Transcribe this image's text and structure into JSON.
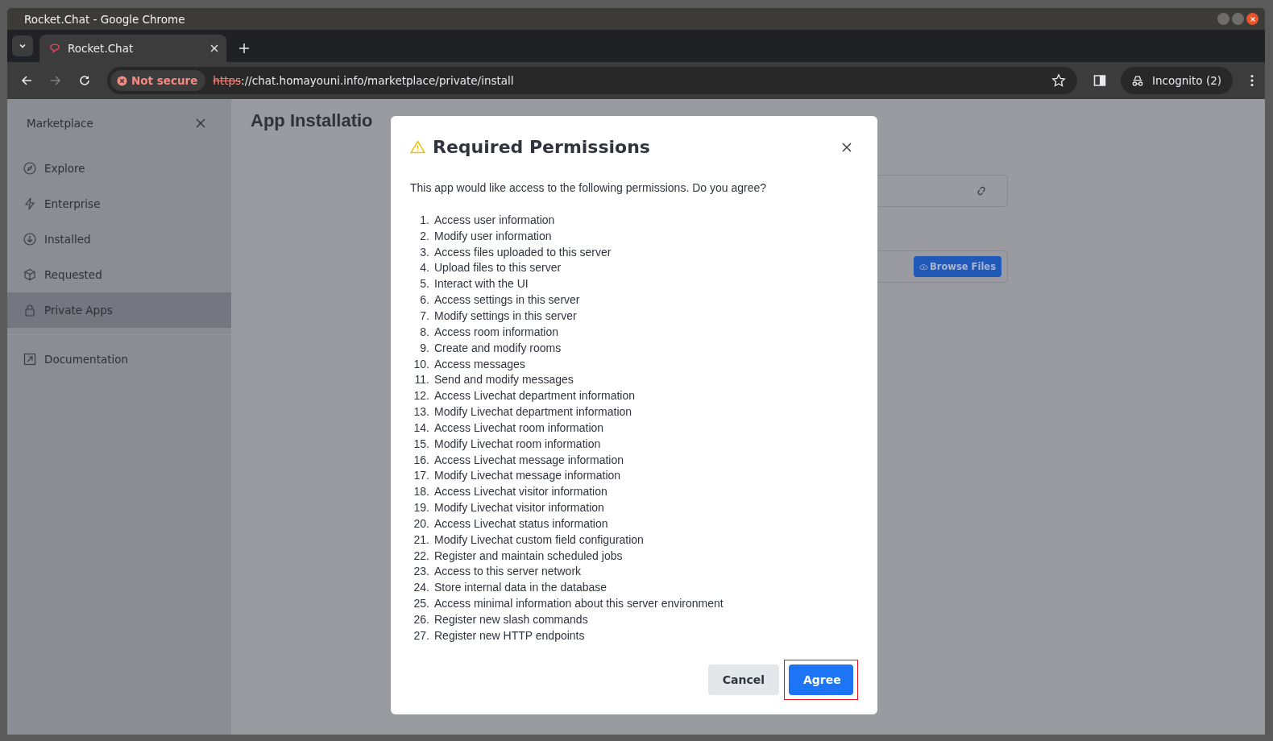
{
  "window": {
    "title": "Rocket.Chat - Google Chrome"
  },
  "tabs": [
    {
      "label": "Rocket.Chat",
      "selected": true
    }
  ],
  "toolbar": {
    "forward_disabled": true,
    "security_label": "Not secure",
    "url_scheme": "https",
    "url_rest": "://chat.homayouni.info/marketplace/private/install",
    "incognito_label": "Incognito (2)"
  },
  "sidebar": {
    "title": "Marketplace",
    "items": [
      {
        "label": "Explore",
        "selected": false
      },
      {
        "label": "Enterprise",
        "selected": false
      },
      {
        "label": "Installed",
        "selected": false
      },
      {
        "label": "Requested",
        "selected": false
      },
      {
        "label": "Private Apps",
        "selected": true
      }
    ],
    "links": [
      {
        "label": "Documentation"
      }
    ]
  },
  "main": {
    "title": "App Installatio",
    "browse_button": "Browse Files"
  },
  "dialog": {
    "title": "Required Permissions",
    "intro": "This app would like access to the following permissions. Do you agree?",
    "permissions": [
      {
        "number": "1.",
        "text": "Access user information"
      },
      {
        "number": "2.",
        "text": "Modify user information"
      },
      {
        "number": "3.",
        "text": "Access files uploaded to this server"
      },
      {
        "number": "4.",
        "text": "Upload files to this server"
      },
      {
        "number": "5.",
        "text": "Interact with the UI"
      },
      {
        "number": "6.",
        "text": "Access settings in this server"
      },
      {
        "number": "7.",
        "text": "Modify settings in this server"
      },
      {
        "number": "8.",
        "text": "Access room information"
      },
      {
        "number": "9.",
        "text": "Create and modify rooms"
      },
      {
        "number": "10.",
        "text": "Access messages"
      },
      {
        "number": "11.",
        "text": "Send and modify messages"
      },
      {
        "number": "12.",
        "text": "Access Livechat department information"
      },
      {
        "number": "13.",
        "text": "Modify Livechat department information"
      },
      {
        "number": "14.",
        "text": "Access Livechat room information"
      },
      {
        "number": "15.",
        "text": "Modify Livechat room information"
      },
      {
        "number": "16.",
        "text": "Access Livechat message information"
      },
      {
        "number": "17.",
        "text": "Modify Livechat message information"
      },
      {
        "number": "18.",
        "text": "Access Livechat visitor information"
      },
      {
        "number": "19.",
        "text": "Modify Livechat visitor information"
      },
      {
        "number": "20.",
        "text": "Access Livechat status information"
      },
      {
        "number": "21.",
        "text": "Modify Livechat custom field configuration"
      },
      {
        "number": "22.",
        "text": "Register and maintain scheduled jobs"
      },
      {
        "number": "23.",
        "text": "Access to this server network"
      },
      {
        "number": "24.",
        "text": "Store internal data in the database"
      },
      {
        "number": "25.",
        "text": "Access minimal information about this server environment"
      },
      {
        "number": "26.",
        "text": "Register new slash commands"
      },
      {
        "number": "27.",
        "text": "Register new HTTP endpoints"
      }
    ],
    "buttons": [
      {
        "label": "Cancel",
        "kind": "secondary",
        "highlighted": false
      },
      {
        "label": "Agree",
        "kind": "primary",
        "highlighted": true
      }
    ]
  }
}
